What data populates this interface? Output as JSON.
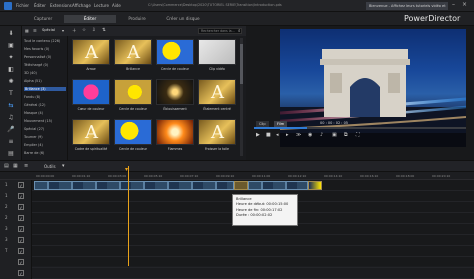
{
  "title_bar": {
    "menus": [
      "Fichier",
      "Éditer",
      "Extensions",
      "Affichage",
      "Lecture",
      "Aide"
    ],
    "file_path": "C:\\Users\\Commerce\\Desktop\\2020\\TUTORIEL SERIE\\Transition\\Introduction.pds",
    "browser_tab": "Bienvenue - Affichez leurs tutoriels vidéo et"
  },
  "mode_tabs": [
    "Capturer",
    "Éditer",
    "Produire",
    "Créer un disque"
  ],
  "active_mode": "Éditer",
  "brand": "PowerDirector",
  "library": {
    "filter": "Spécial",
    "search_placeholder": "Rechercher dans la..."
  },
  "categories": [
    "Tout le contenu (226)",
    "Mes favoris (0)",
    "Personnalisé (0)",
    "Téléchargé (0)",
    "3D (40)",
    "Alpha (51)",
    "Brillance (3)",
    "Fondu (8)",
    "Général (12)",
    "Masque (4)",
    "Mouvement (15)",
    "Spécial (27)",
    "Tourner (9)",
    "Empiler (4)",
    "Barre de (6)"
  ],
  "selected_category": "Spécial",
  "transitions": [
    {
      "label": "Arrow",
      "style": "gold"
    },
    {
      "label": "Brillance",
      "style": "gold"
    },
    {
      "label": "Cercle de couleur",
      "style": "blob"
    },
    {
      "label": "Clip vidéo",
      "style": "white"
    },
    {
      "label": "Cœur de couleur",
      "style": "heart"
    },
    {
      "label": "Cercle de couleur",
      "style": "blob2"
    },
    {
      "label": "Éblouissement",
      "style": "dark"
    },
    {
      "label": "Étalement centré",
      "style": "gold"
    },
    {
      "label": "Cadre de spiritualité",
      "style": "gold"
    },
    {
      "label": "Cercle de couleur",
      "style": "blob"
    },
    {
      "label": "Flammes",
      "style": "flame"
    },
    {
      "label": "Froisser la toile",
      "style": "gold"
    }
  ],
  "preview": {
    "time_display": "00 : 00 : 02 : 05",
    "modes": [
      "Clip",
      "Film"
    ],
    "playback": 0.25
  },
  "timeline": {
    "toolbar_label": "Outils",
    "ruler": [
      "00:00:00:00",
      "00:00:01:10",
      "00:00:03:00",
      "00:00:05:10",
      "00:00:07:10",
      "00:00:09:10",
      "00:00:11:00",
      "00:00:12:10",
      "00:00:14:10",
      "00:00:16:10",
      "00:00:18:00",
      "00:00:20:10"
    ],
    "tracks": [
      "1",
      "1",
      "2",
      "2",
      "3",
      "3",
      "T",
      "",
      ""
    ]
  },
  "tooltip": {
    "lines": [
      "Brillance",
      "Heure de début: 00:00:15:00",
      "Heure de fin: 00:00:17:02",
      "Durée : 00:00:02:02"
    ]
  },
  "colors": {
    "accent": "#2f7bd6",
    "playhead": "#e8a21a"
  }
}
